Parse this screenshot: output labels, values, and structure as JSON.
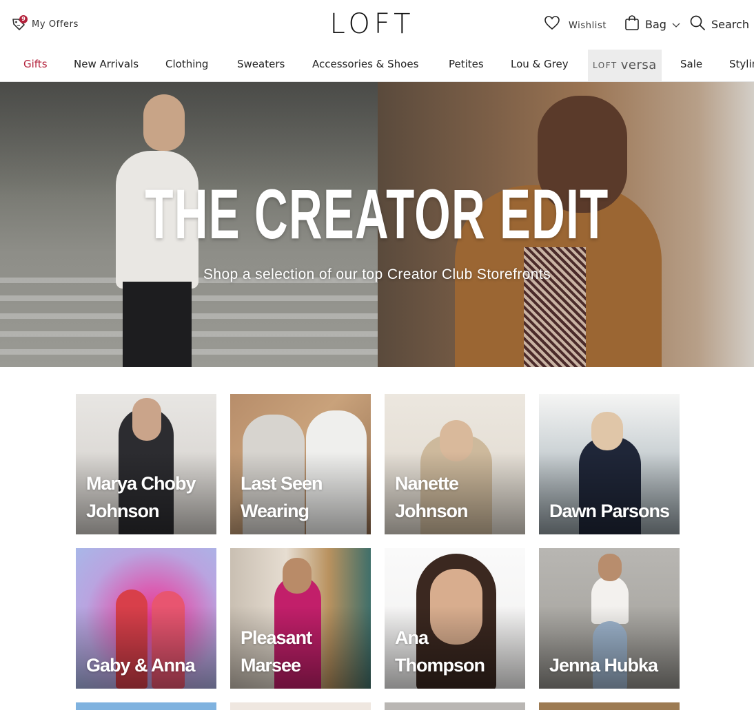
{
  "header": {
    "offers_label": "My Offers",
    "offers_badge": "9",
    "logo": "LOFT",
    "wishlist_label": "Wishlist",
    "bag_label": "Bag",
    "search_label": "Search"
  },
  "nav": {
    "items": [
      {
        "label": "Gifts"
      },
      {
        "label": "New Arrivals"
      },
      {
        "label": "Clothing"
      },
      {
        "label": "Sweaters"
      },
      {
        "label": "Accessories & Shoes"
      },
      {
        "label": "Petites"
      },
      {
        "label": "Lou & Grey"
      },
      {
        "label": "Sale"
      },
      {
        "label": "Stylin"
      }
    ],
    "versa": {
      "prefix": "LOFT",
      "word": "versa"
    }
  },
  "hero": {
    "title": "THE CREATOR EDIT",
    "subtitle": "Shop a selection of our top Creator Club Storefronts"
  },
  "creators": [
    {
      "name": "Marya Choby Johnson"
    },
    {
      "name": "Last Seen Wearing"
    },
    {
      "name": "Nanette Johnson"
    },
    {
      "name": "Dawn Parsons"
    },
    {
      "name": "Gaby & Anna"
    },
    {
      "name": "Pleasant Marsee"
    },
    {
      "name": "Ana Thompson"
    },
    {
      "name": "Jenna Hubka"
    }
  ],
  "colors": {
    "accent": "#b3203a",
    "text": "#222222",
    "nav_highlight_bg": "#ececec"
  }
}
